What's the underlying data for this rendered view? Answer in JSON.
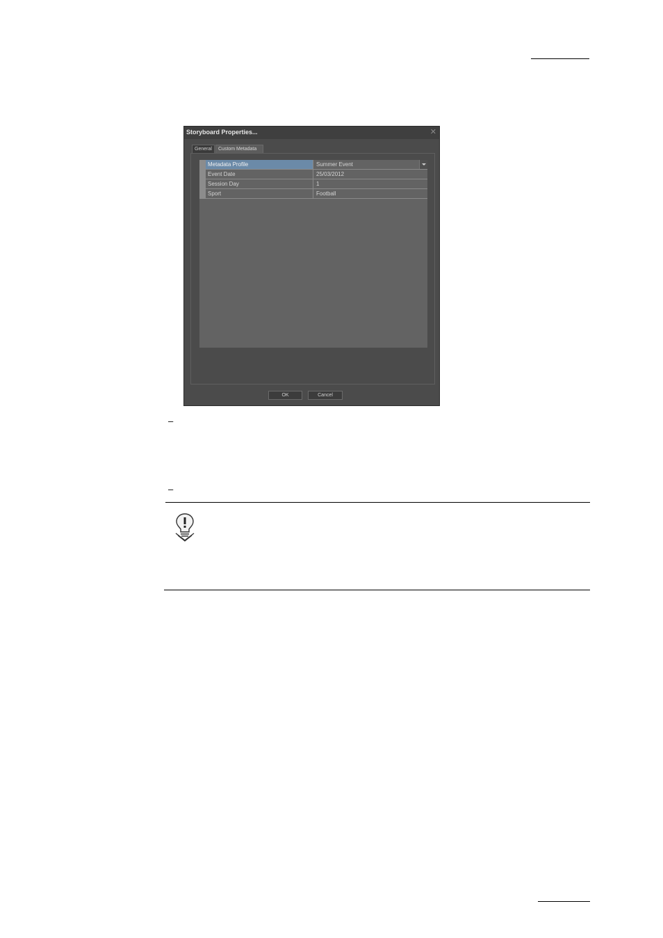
{
  "page": {
    "bullet_1": "–",
    "bullet_2": "–"
  },
  "dialog": {
    "title": "Storyboard Properties...",
    "close_glyph": "✕",
    "tabs": [
      {
        "label": "General",
        "active": false
      },
      {
        "label": "Custom Metadata",
        "active": true
      }
    ],
    "rows": [
      {
        "name": "Metadata Profile",
        "value": "Summer Event",
        "has_dropdown": true
      },
      {
        "name": "Event Date",
        "value": "25/03/2012"
      },
      {
        "name": "Session Day",
        "value": "1"
      },
      {
        "name": "Sport",
        "value": "Football"
      }
    ],
    "buttons": {
      "ok": "OK",
      "cancel": "Cancel"
    }
  },
  "note": {
    "icon": "note-bulb-icon"
  },
  "colors": {
    "dialog_bg": "#4b4b4b",
    "grid_bg": "#636363",
    "selection": "#6b8aa8"
  }
}
